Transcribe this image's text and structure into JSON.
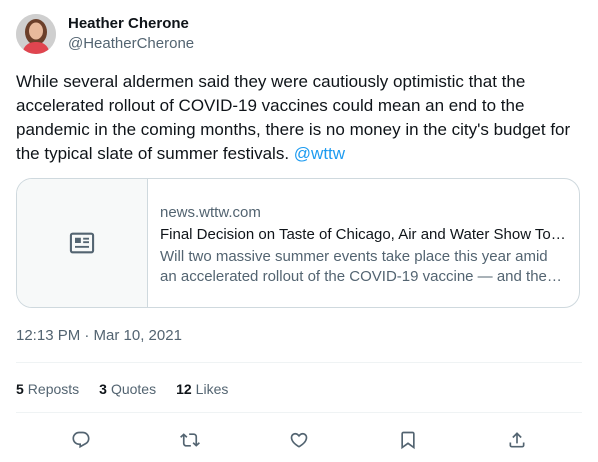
{
  "author": {
    "display_name": "Heather Cherone",
    "handle": "@HeatherCherone"
  },
  "tweet": {
    "text": "While several aldermen said they were cautiously optimistic that the accelerated rollout of COVID-19 vaccines could mean an end to the pandemic in the coming months, there is no money in the city's budget for the typical slate of summer festivals.",
    "mention": "@wttw"
  },
  "card": {
    "domain": "news.wttw.com",
    "title": "Final Decision on Taste of Chicago, Air and Water Show To Come in April",
    "description": "Will two massive summer events take place this year amid an accelerated rollout of the COVID-19 vaccine — and the end of the pandemic?",
    "thumb_icon": "article-icon"
  },
  "timestamp": "12:13 PM · Mar 10, 2021",
  "stats": {
    "reposts_count": "5",
    "reposts_label": "Reposts",
    "quotes_count": "3",
    "quotes_label": "Quotes",
    "likes_count": "12",
    "likes_label": "Likes"
  },
  "actions": [
    "reply-icon",
    "repost-icon",
    "like-icon",
    "bookmark-icon",
    "share-icon"
  ],
  "colors": {
    "link": "#1d9bf0",
    "secondary_text": "#536471",
    "primary_text": "#0f1419",
    "border": "#cfd9de"
  }
}
